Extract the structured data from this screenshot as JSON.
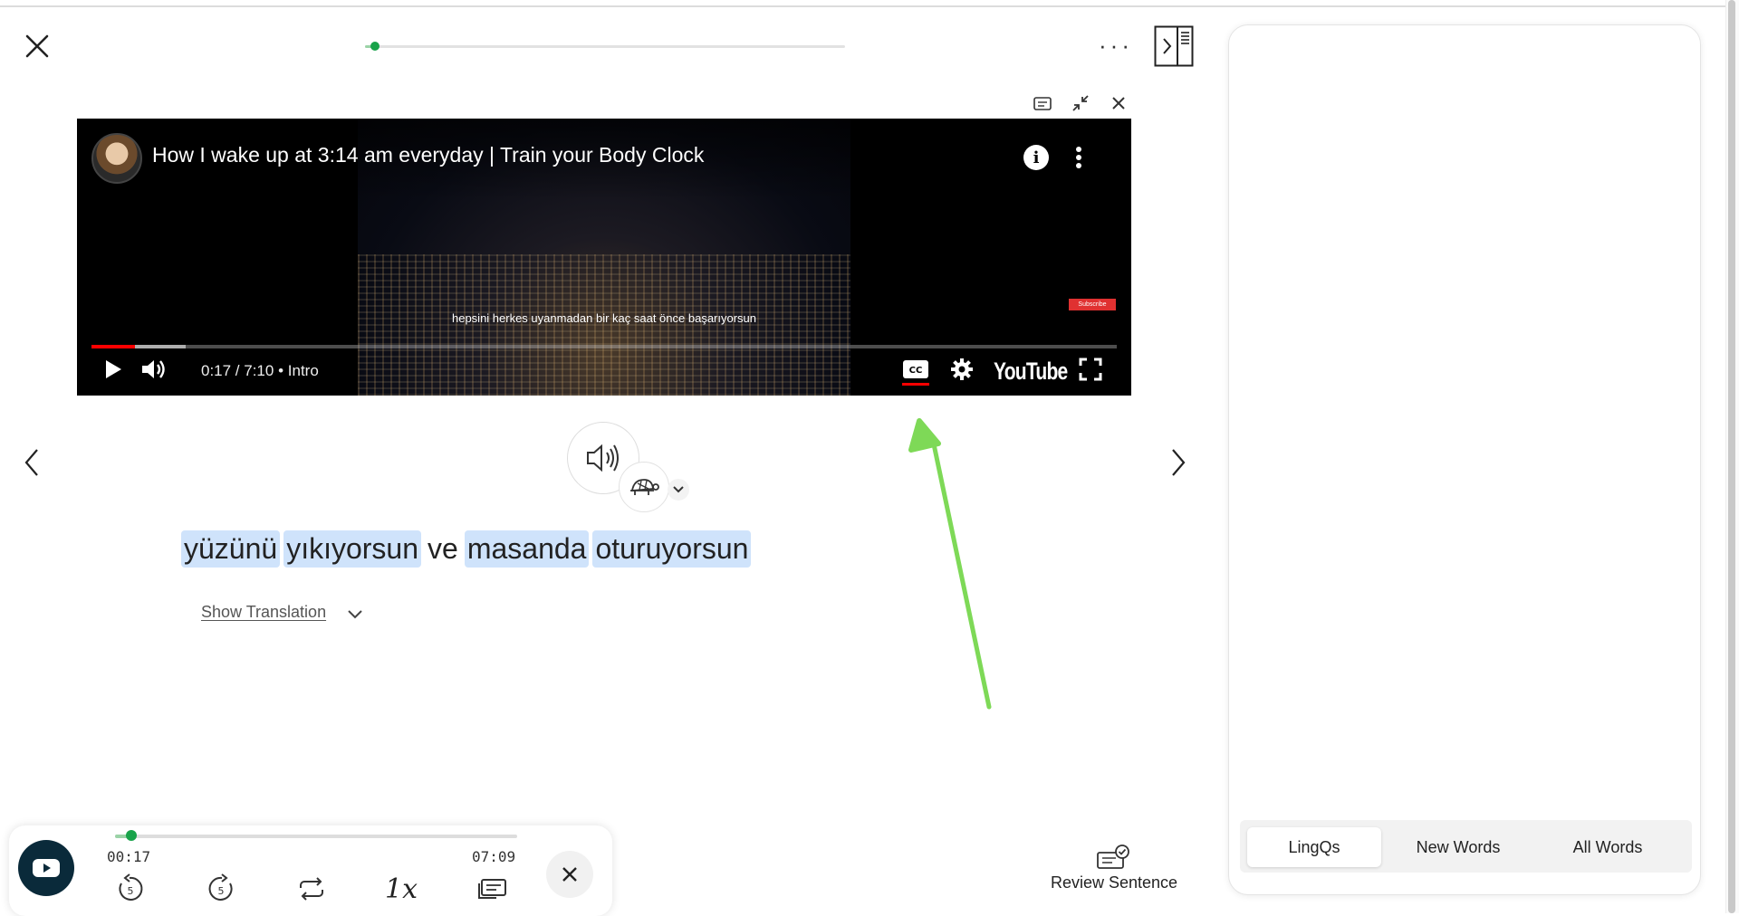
{
  "lesson": {
    "progress_fraction": 0.02,
    "more_label": "···"
  },
  "video": {
    "title": "How I wake up at 3:14 am everyday | Train your Body Clock",
    "subtitle": "hepsini herkes uyanmadan bir kaç saat önce başarıyorsun",
    "time": "0:17 / 7:10",
    "chapter": "Intro",
    "brand": "YouTube",
    "subscribe": "Subscribe",
    "played_fraction": 0.04
  },
  "sentence": {
    "words": [
      {
        "text": "yüzünü",
        "highlighted": true
      },
      {
        "text": "yıkıyorsun",
        "highlighted": true
      },
      {
        "text": "ve",
        "highlighted": false
      },
      {
        "text": "masanda",
        "highlighted": true
      },
      {
        "text": "oturuyorsun",
        "highlighted": true
      }
    ],
    "show_translation": "Show Translation"
  },
  "player": {
    "elapsed": "00:17",
    "total": "07:09",
    "progress_fraction": 0.04,
    "speed": "1x",
    "rewind_seconds": "5",
    "forward_seconds": "5"
  },
  "review": {
    "label": "Review Sentence"
  },
  "right_panel": {
    "tabs": [
      {
        "label": "LingQs",
        "active": true
      },
      {
        "label": "New Words",
        "active": false
      },
      {
        "label": "All Words",
        "active": false
      }
    ]
  },
  "colors": {
    "highlight": "#cfe3fb",
    "accent_green": "#18a34a",
    "annotation_arrow": "#7ed957",
    "yt_red": "#ff0000"
  }
}
